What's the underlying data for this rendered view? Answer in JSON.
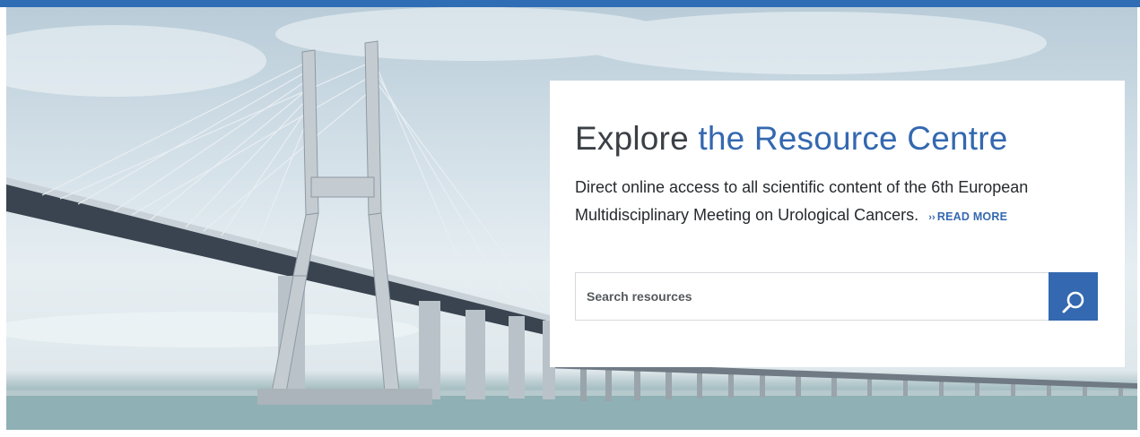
{
  "colors": {
    "top_bar": "#2f6db5",
    "accent": "#3468b0",
    "heading_text": "#3b4046",
    "body_text": "#262a2e"
  },
  "hero": {
    "image": "cable-stayed bridge over water"
  },
  "card": {
    "title_plain": "Explore",
    "title_accent": "the Resource Centre",
    "description": "Direct online access to all scientific content of the 6th European Multidisciplinary Meeting on Urological Cancers.",
    "read_more": {
      "chevron": "››",
      "label": "READ MORE"
    },
    "search": {
      "placeholder": "Search resources",
      "value": "",
      "button_icon": "search-icon"
    }
  }
}
